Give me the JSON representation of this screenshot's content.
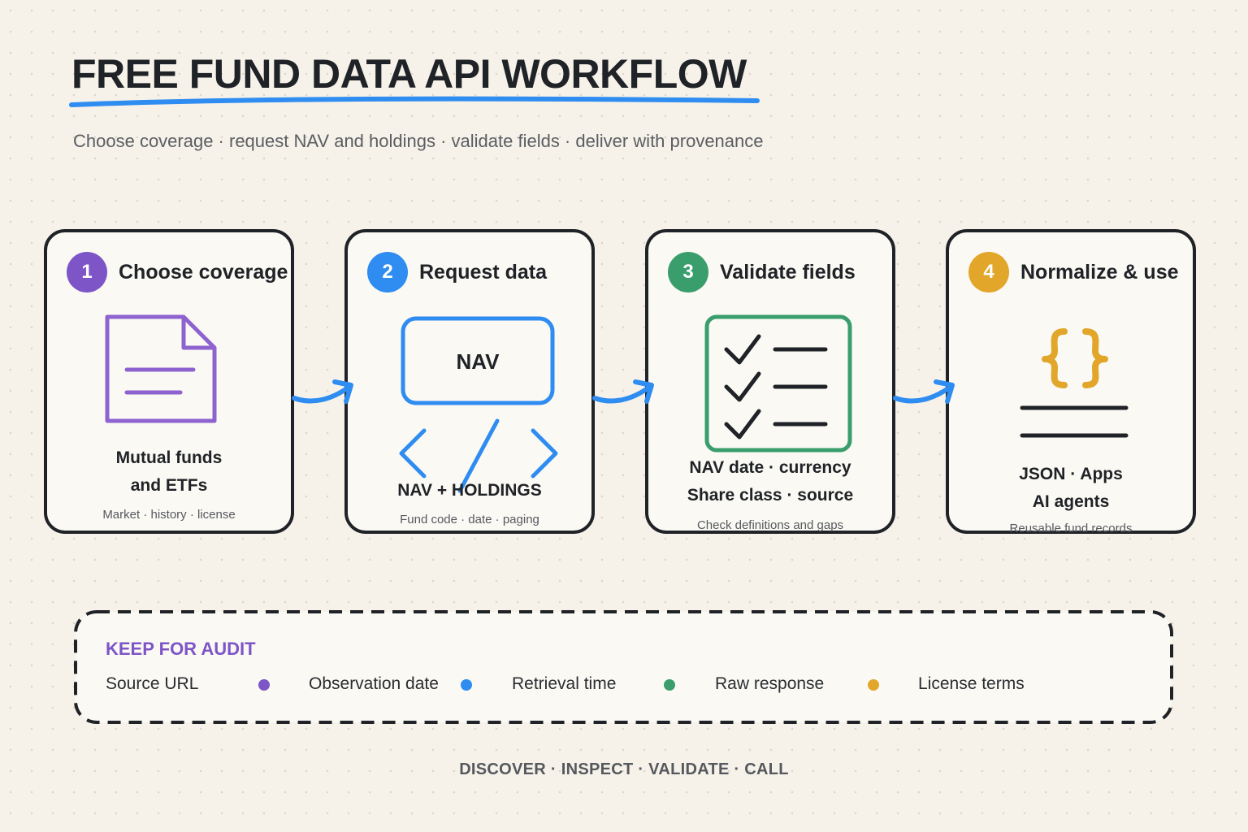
{
  "title": "FREE FUND DATA API WORKFLOW",
  "subtitle": "Choose coverage · request NAV and holdings · validate fields · deliver with provenance",
  "colors": {
    "purple": "#7d55c7",
    "blue": "#2f8cf0",
    "green": "#3a9e6c",
    "yellow": "#e2a62a",
    "dark": "#1f2226"
  },
  "steps": [
    {
      "number": "1",
      "title": "Choose coverage",
      "icon": "document-icon",
      "main_line1": "Mutual funds",
      "main_line2": "and ETFs",
      "sub": "Market · history · license"
    },
    {
      "number": "2",
      "title": "Request data",
      "icon": "code-icon",
      "box_label": "NAV",
      "main_line1": "NAV + HOLDINGS",
      "sub": "Fund code · date · paging"
    },
    {
      "number": "3",
      "title": "Validate fields",
      "icon": "checklist-icon",
      "main_line1": "NAV date · currency",
      "main_line2": "Share class · source",
      "sub": "Check definitions and gaps"
    },
    {
      "number": "4",
      "title": "Normalize & use",
      "icon": "braces-icon",
      "main_line1": "JSON · Apps",
      "main_line2": "AI agents",
      "sub": "Reusable fund records"
    }
  ],
  "audit": {
    "heading": "KEEP FOR AUDIT",
    "items": [
      "Source URL",
      "Observation date",
      "Retrieval time",
      "Raw response",
      "License terms"
    ]
  },
  "footer": "DISCOVER · INSPECT · VALIDATE · CALL"
}
